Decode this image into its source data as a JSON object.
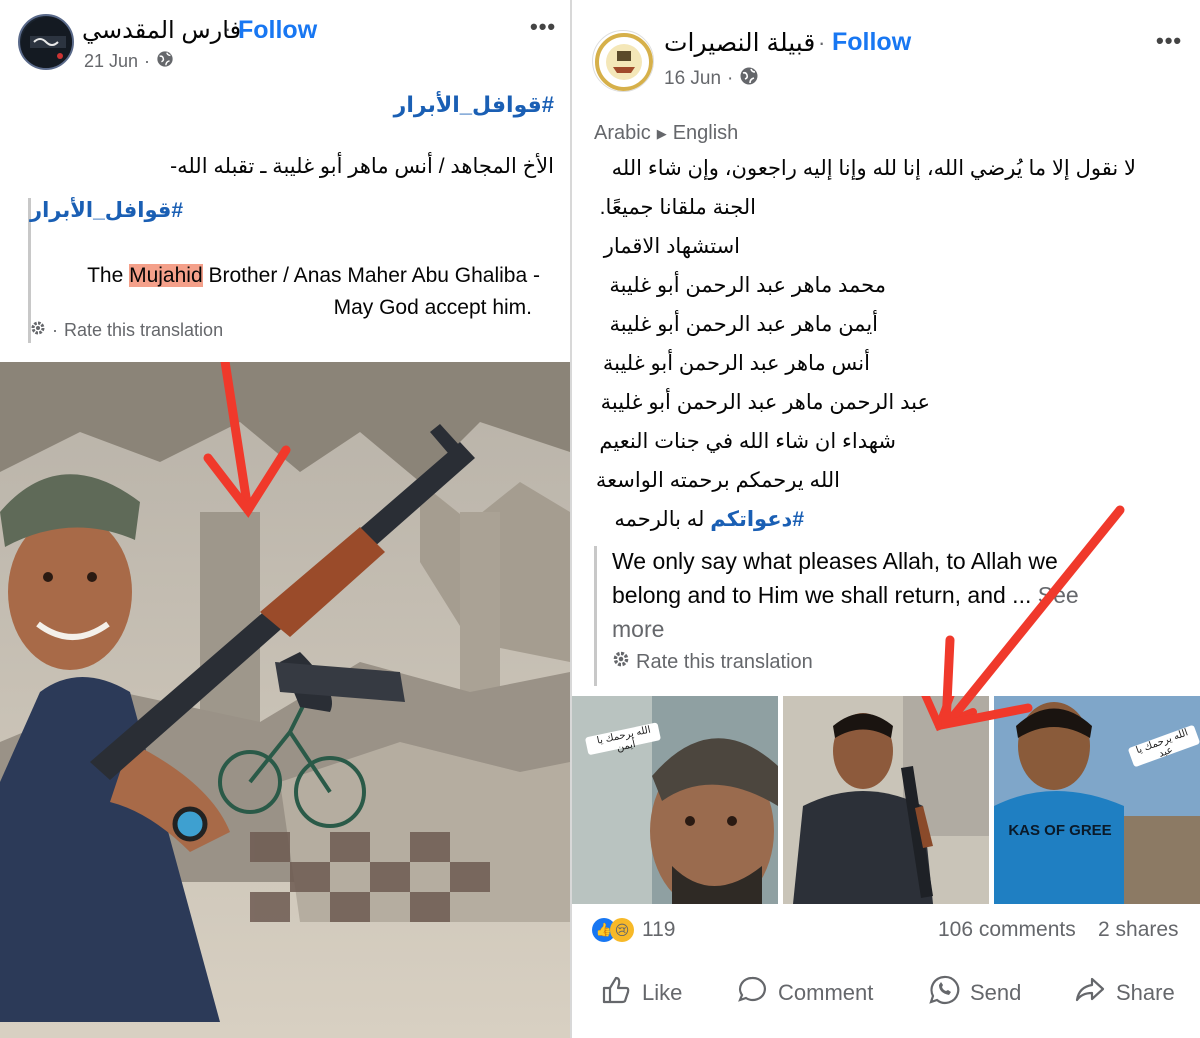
{
  "left_post": {
    "page_name": "فارس المقدسي",
    "follow_label": "Follow",
    "date": "21 Jun",
    "hashtag": "#قوافل_الأبرار",
    "text_ar": "الأخ المجاهد / أنس ماهر أبو غليبة ـ تقبله الله-",
    "translation": {
      "hashtag": "#قوافل_الأبرار",
      "text_pre": "The ",
      "text_highlight": "Mujahid",
      "text_post": " Brother / Anas Maher Abu Ghaliba -",
      "text_line2": "May God accept him.",
      "rate_label": "Rate this translation"
    }
  },
  "right_post": {
    "page_name": "قبيلة النصيرات",
    "follow_label": "Follow",
    "date": "16 Jun",
    "lang_from": "Arabic",
    "lang_to": "English",
    "lines_ar": [
      "لا نقول إلا ما يُرضي الله، إنا لله وإنا إليه راجعون، وإن شاء الله",
      "الجنة ملقانا جميعًا.",
      "استشهاد الاقمار",
      "محمد ماهر عبد الرحمن أبو غليبة",
      "أيمن ماهر عبد الرحمن أبو غليبة",
      "أنس ماهر عبد الرحمن أبو غليبة",
      "عبد الرحمن ماهر عبد الرحمن أبو غليبة",
      "شهداء ان شاء الله في جنات النعيم",
      "الله يرحمكم برحمته الواسعة"
    ],
    "last_line_hashtag": "#دعواتكم",
    "last_line_text": " له بالرحمه",
    "translation": {
      "line1": "We only say what pleases Allah, to Allah we",
      "line2": "belong and to Him we shall return, and ...",
      "see_more": "See",
      "line3": "more",
      "rate_label": "Rate this translation"
    },
    "photo_captions": [
      "الله يرحمك يا أيمن",
      "الله يرحمك يا عبد"
    ],
    "sweater_text": "KAS OF GREE",
    "reaction_count": "119",
    "comments": "106 comments",
    "shares": "2 shares",
    "actions": {
      "like": "Like",
      "comment": "Comment",
      "send": "Send",
      "share": "Share"
    }
  },
  "colors": {
    "accent": "#1877f2",
    "hashtag": "#1a5fb4",
    "highlight": "#f4a08a",
    "arrow": "#f0392b",
    "muted": "#65676b"
  }
}
